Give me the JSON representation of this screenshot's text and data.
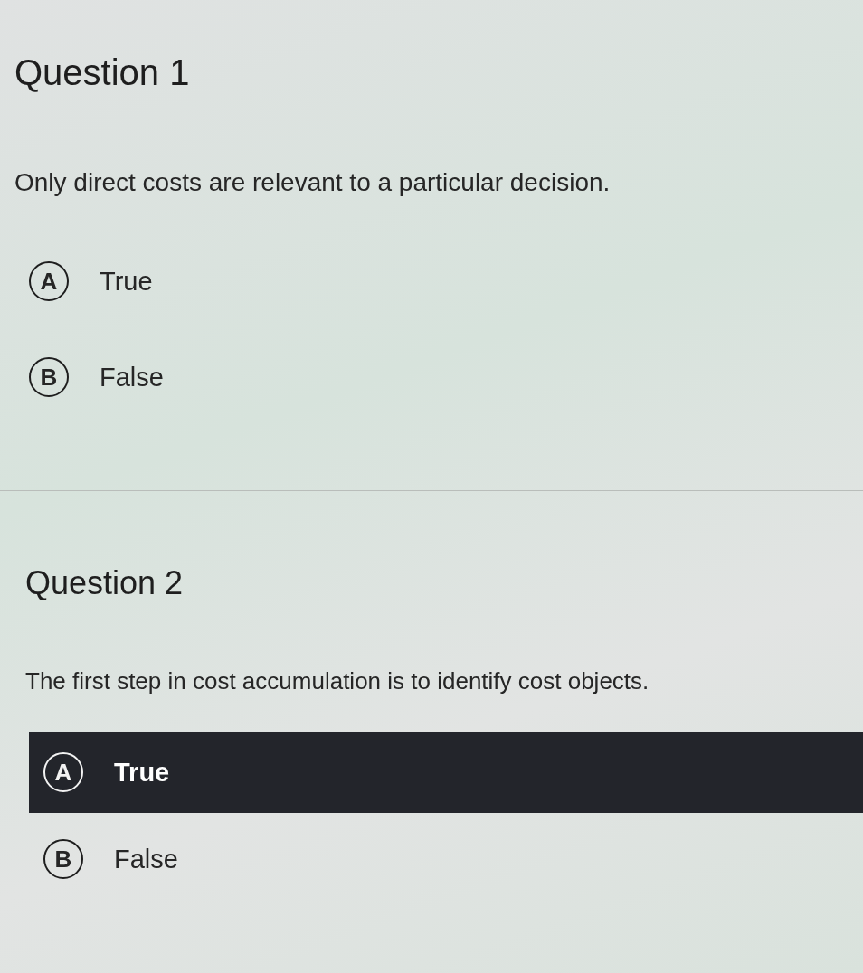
{
  "questions": [
    {
      "title": "Question 1",
      "prompt": "Only direct costs are relevant to a particular decision.",
      "options": [
        {
          "letter": "A",
          "label": "True",
          "selected": false
        },
        {
          "letter": "B",
          "label": "False",
          "selected": false
        }
      ]
    },
    {
      "title": "Question 2",
      "prompt": "The first step in cost accumulation is to identify cost objects.",
      "options": [
        {
          "letter": "A",
          "label": "True",
          "selected": true
        },
        {
          "letter": "B",
          "label": "False",
          "selected": false
        }
      ]
    }
  ]
}
